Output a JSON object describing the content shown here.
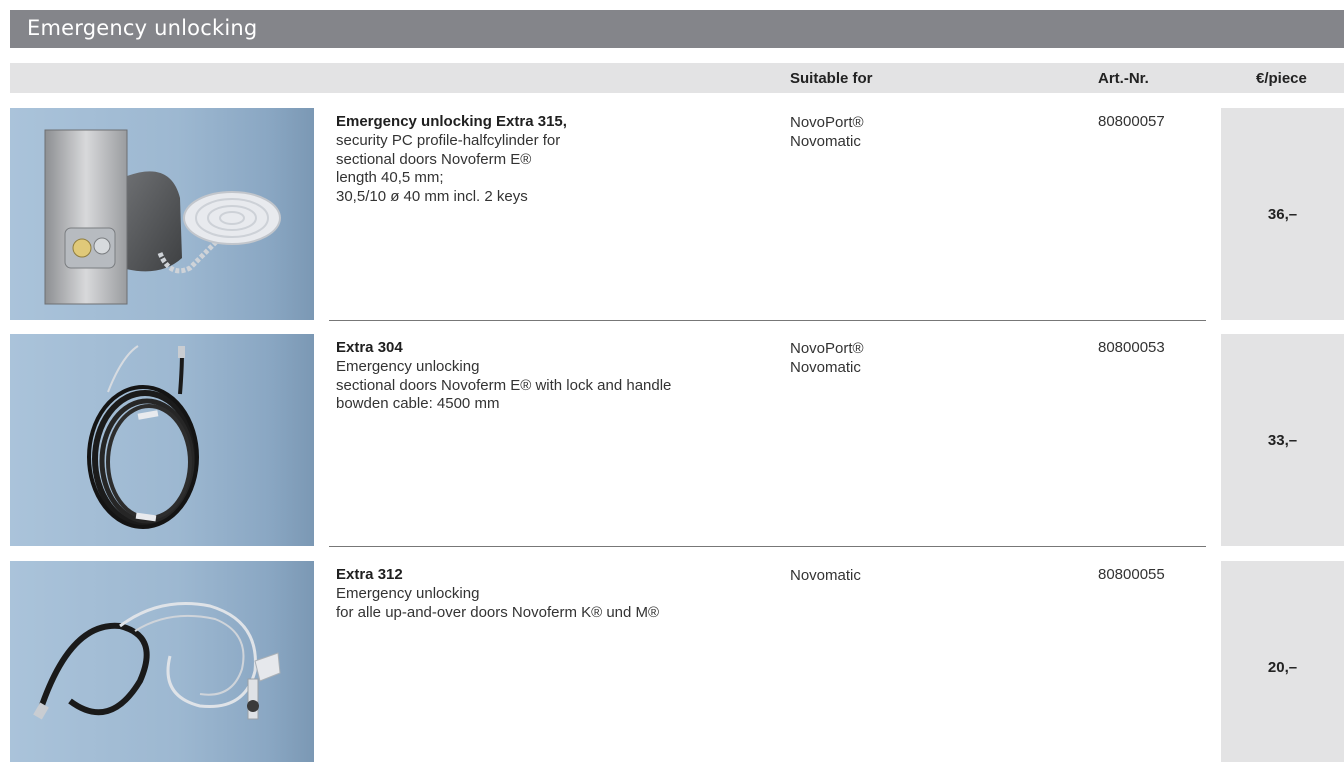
{
  "section": {
    "title": "Emergency unlocking"
  },
  "table_header": {
    "suitable_for": "Suitable for",
    "art_nr": "Art.-Nr.",
    "price_unit": "€/piece"
  },
  "products": [
    {
      "name": "Emergency unlocking Extra 315,",
      "description": "security PC profile-halfcylinder for\nsectional doors Novoferm E®\nlength 40,5 mm;\n30,5/10 ø 40 mm incl. 2 keys",
      "suitable_for": "NovoPort®\nNovomatic",
      "art_nr": "80800057",
      "price": "36,–",
      "image_icon": "lock-cylinder-with-cable-image"
    },
    {
      "name": "Extra 304",
      "description": "Emergency unlocking\nsectional doors Novoferm E® with lock and handle\nbowden cable: 4500 mm",
      "suitable_for": "NovoPort®\nNovomatic",
      "art_nr": "80800053",
      "price": "33,–",
      "image_icon": "coiled-bowden-cable-image"
    },
    {
      "name": "Extra 312",
      "description": "Emergency unlocking\nfor alle up-and-over doors Novoferm K® und M®",
      "suitable_for": "Novomatic",
      "art_nr": "80800055",
      "price": "20,–",
      "image_icon": "cable-with-handle-image"
    }
  ],
  "colors": {
    "title_bar": "#84858a",
    "header_bar": "#e3e3e4",
    "price_column": "#e3e3e4",
    "image_background": "#9db8d1"
  }
}
